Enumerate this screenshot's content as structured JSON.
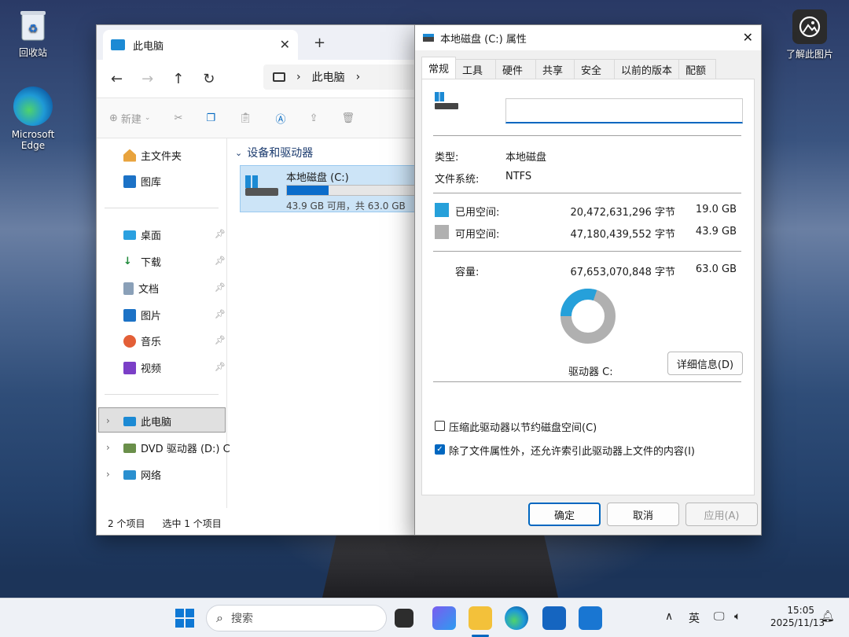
{
  "desktop": {
    "recycle_bin": "回收站",
    "edge": "Microsoft Edge",
    "learn_picture": "了解此图片"
  },
  "explorer": {
    "tab_title": "此电脑",
    "address": "此电脑",
    "toolbar_new": "新建",
    "sidebar_top": [
      "主文件夹",
      "图库"
    ],
    "sidebar_pinned": [
      "桌面",
      "下载",
      "文档",
      "图片",
      "音乐",
      "视频"
    ],
    "sidebar_tree": [
      "此电脑",
      "DVD 驱动器 (D:) C",
      "网络"
    ],
    "section_title": "设备和驱动器",
    "drive_name": "本地磁盘 (C:)",
    "drive_usage": 0.3,
    "drive_free_text": "43.9 GB 可用，共 63.0 GB",
    "status_items": "2 个项目",
    "status_selected": "选中 1 个项目"
  },
  "dialog": {
    "title": "本地磁盘 (C:) 属性",
    "tabs": [
      "常规",
      "工具",
      "硬件",
      "共享",
      "安全",
      "以前的版本",
      "配额"
    ],
    "active_tab": "常规",
    "name_value": "",
    "type_label": "类型:",
    "type_value": "本地磁盘",
    "fs_label": "文件系统:",
    "fs_value": "NTFS",
    "used_label": "已用空间:",
    "used_bytes": "20,472,631,296 字节",
    "used_gb": "19.0 GB",
    "free_label": "可用空间:",
    "free_bytes": "47,180,439,552 字节",
    "free_gb": "43.9 GB",
    "cap_label": "容量:",
    "cap_bytes": "67,653,070,848 字节",
    "cap_gb": "63.0 GB",
    "drive_label": "驱动器 C:",
    "details_button": "详细信息(D)",
    "compress_label": "压缩此驱动器以节约磁盘空间(C)",
    "compress_checked": false,
    "index_label": "除了文件属性外，还允许索引此驱动器上文件的内容(I)",
    "index_checked": true,
    "ok": "确定",
    "cancel": "取消",
    "apply": "应用(A)",
    "used_fraction": 0.302,
    "colors": {
      "used": "#26a0da",
      "free": "#b0b0b0"
    }
  },
  "taskbar": {
    "search_placeholder": "搜索",
    "ime": "英",
    "time": "15:05",
    "date": "2025/11/13"
  }
}
